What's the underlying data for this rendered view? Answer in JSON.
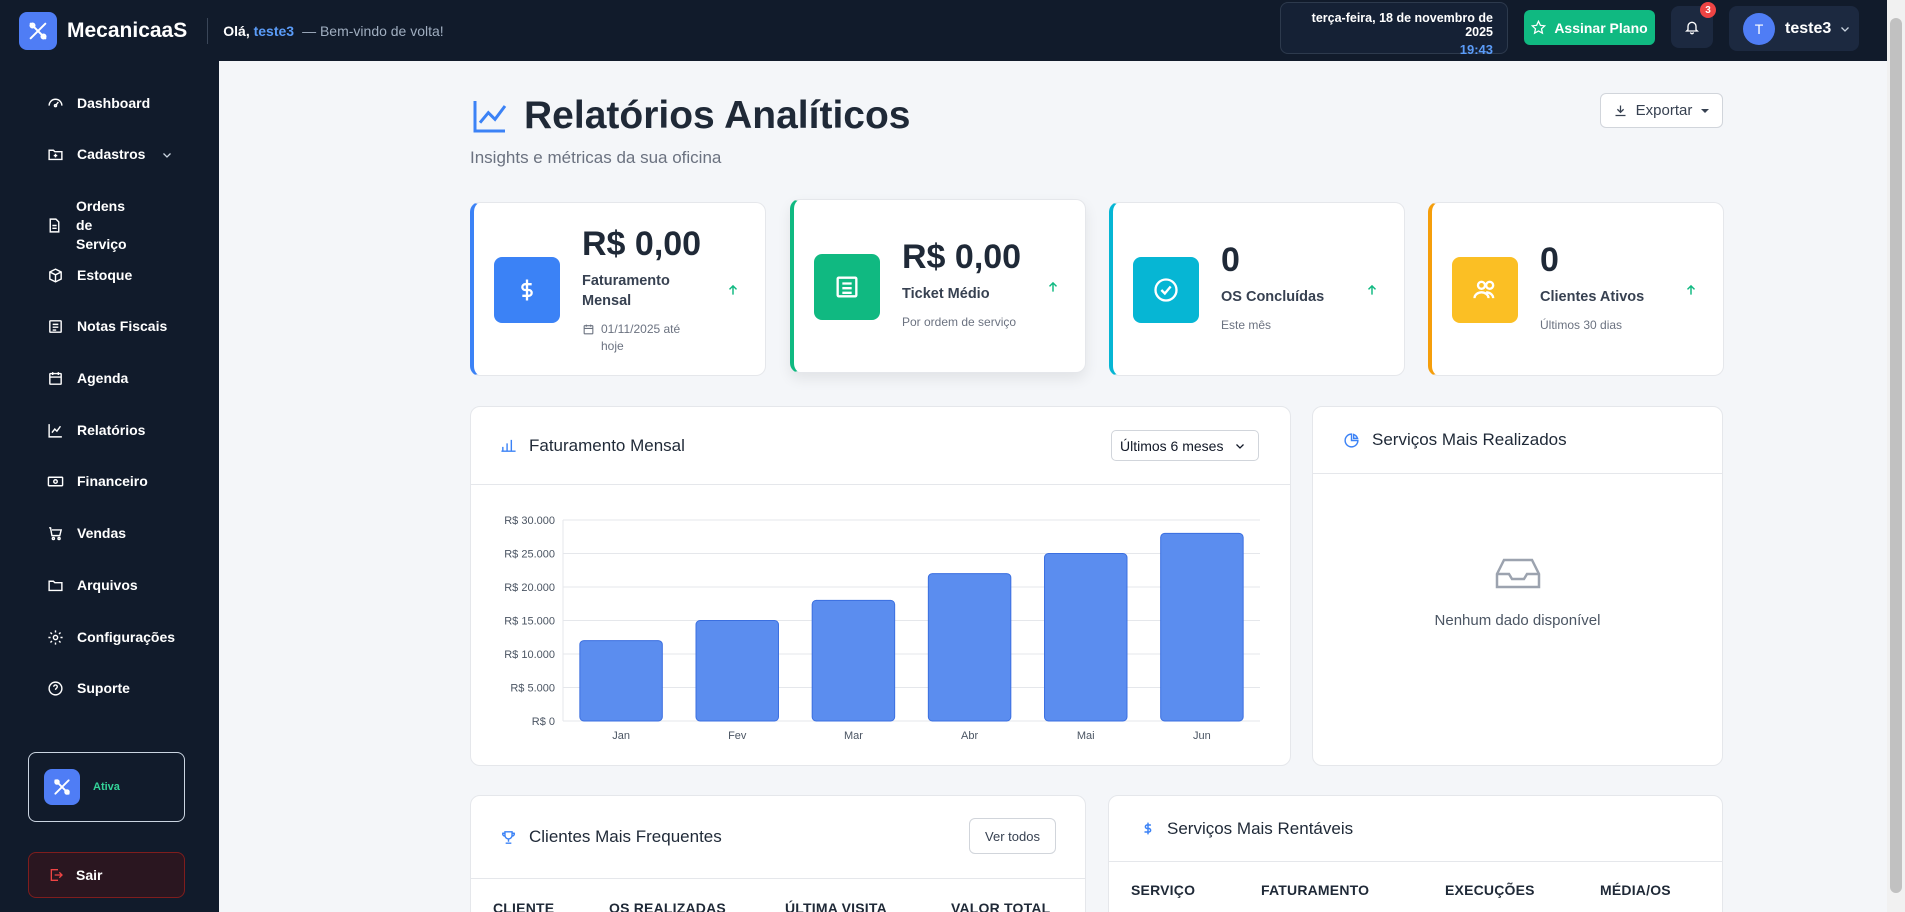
{
  "app": {
    "name": "MecanicaaS"
  },
  "greeting": {
    "hello": "Olá, ",
    "user": "teste3",
    "subtitle": "— Bem-vindo de volta!"
  },
  "datetime": {
    "date": "terça-feira, 18 de novembro de 2025",
    "time": "19:43"
  },
  "topbar": {
    "plan_button": "Assinar Plano",
    "notifications_count": "3",
    "avatar_initial": "T",
    "username": "teste3"
  },
  "sidebar": {
    "items": [
      {
        "label": "Dashboard",
        "icon": "gauge-icon"
      },
      {
        "label": "Cadastros",
        "icon": "folder-plus-icon"
      },
      {
        "label": "Ordens de Serviço",
        "icon": "document-icon"
      },
      {
        "label": "Estoque",
        "icon": "box-icon"
      },
      {
        "label": "Notas Fiscais",
        "icon": "receipt-icon"
      },
      {
        "label": "Agenda",
        "icon": "calendar-icon"
      },
      {
        "label": "Relatórios",
        "icon": "chart-line-icon"
      },
      {
        "label": "Financeiro",
        "icon": "money-icon"
      },
      {
        "label": "Vendas",
        "icon": "cart-icon"
      },
      {
        "label": "Arquivos",
        "icon": "folder-icon"
      },
      {
        "label": "Configurações",
        "icon": "gear-icon"
      },
      {
        "label": "Suporte",
        "icon": "question-icon"
      }
    ],
    "status": "Ativa",
    "logout": "Sair"
  },
  "header": {
    "title": "Relatórios Analíticos",
    "subtitle": "Insights e métricas da sua oficina",
    "export": "Exportar"
  },
  "stats": [
    {
      "value": "R$ 0,00",
      "label": "Faturamento Mensal",
      "hint": "01/11/2025 até hoje",
      "color": "#3b82f6"
    },
    {
      "value": "R$ 0,00",
      "label": "Ticket Médio",
      "hint": "Por ordem de serviço",
      "color": "#10b981"
    },
    {
      "value": "0",
      "label": "OS Concluídas",
      "hint": "Este mês",
      "color": "#06b6d4"
    },
    {
      "value": "0",
      "label": "Clientes Ativos",
      "hint": "Últimos 30 dias",
      "color": "#f59e0b"
    }
  ],
  "revenue_card": {
    "title": "Faturamento Mensal",
    "period": "Últimos 6 meses"
  },
  "services_card": {
    "title": "Serviços Mais Realizados",
    "empty": "Nenhum dado disponível"
  },
  "clients_card": {
    "title": "Clientes Mais Frequentes",
    "view_all": "Ver todos",
    "columns": [
      "CLIENTE",
      "OS REALIZADAS",
      "ÚLTIMA VISITA",
      "VALOR TOTAL"
    ]
  },
  "profitable_card": {
    "title": "Serviços Mais Rentáveis",
    "columns": [
      "SERVIÇO",
      "FATURAMENTO",
      "EXECUÇÕES",
      "MÉDIA/OS"
    ]
  },
  "chart_data": {
    "type": "bar",
    "categories": [
      "Jan",
      "Fev",
      "Mar",
      "Abr",
      "Mai",
      "Jun"
    ],
    "values": [
      12000,
      15000,
      18000,
      22000,
      25000,
      28000
    ],
    "ylim": [
      0,
      30000
    ],
    "yticks": [
      "R$ 0",
      "R$ 5.000",
      "R$ 10.000",
      "R$ 15.000",
      "R$ 20.000",
      "R$ 25.000",
      "R$ 30.000"
    ],
    "color": "#5b8def",
    "grid": true
  }
}
